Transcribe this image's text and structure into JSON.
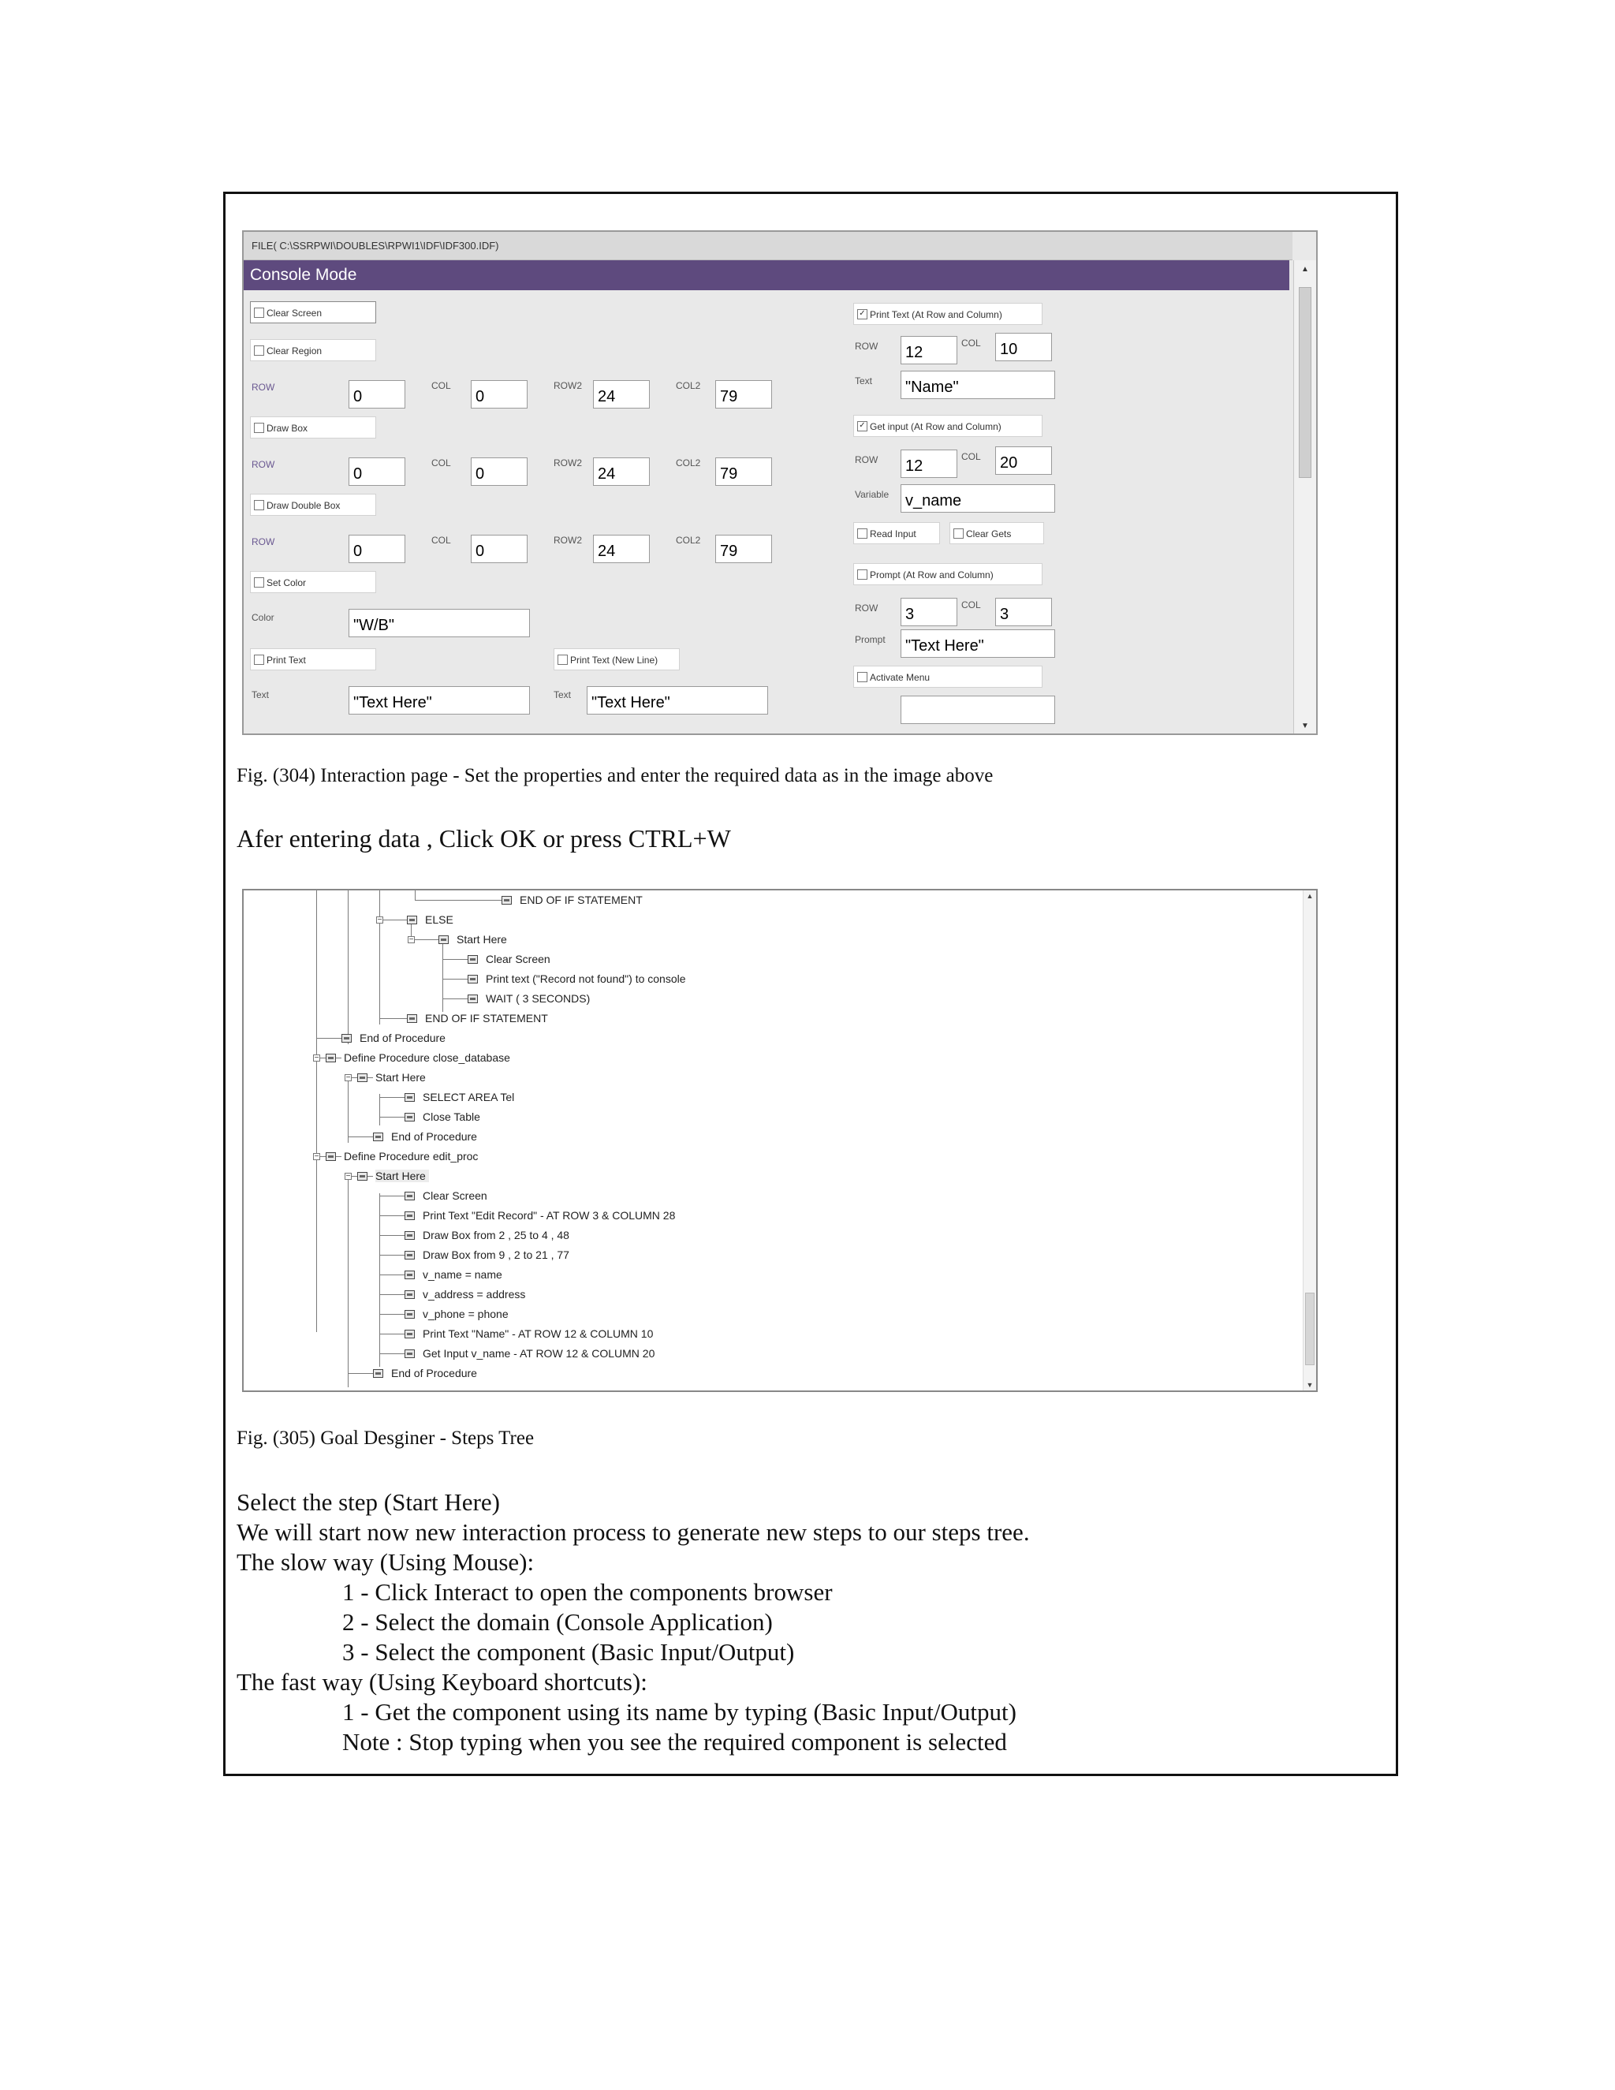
{
  "fig304": {
    "file_path": "FILE( C:\\SSRPWI\\DOUBLES\\RPWI1\\IDF\\IDF300.IDF)",
    "title": "Console Mode",
    "clear_screen": "Clear Screen",
    "clear_region": "Clear Region",
    "draw_box": "Draw Box",
    "draw_double_box": "Draw Double Box",
    "set_color": "Set Color",
    "color_label": "Color",
    "color_value": "\"W/B\"",
    "print_text": "Print Text",
    "print_text_newline": "Print Text (New Line)",
    "text_label": "Text",
    "text_value_1": "\"Text Here\"",
    "text_value_2": "\"Text Here\"",
    "row_label": "ROW",
    "col_label": "COL",
    "row2_label": "ROW2",
    "col2_label": "COL2",
    "region": {
      "row": "0",
      "col": "0",
      "row2": "24",
      "col2": "79"
    },
    "box": {
      "row": "0",
      "col": "0",
      "row2": "24",
      "col2": "79"
    },
    "double_box": {
      "row": "0",
      "col": "0",
      "row2": "24",
      "col2": "79"
    },
    "print_at": {
      "label": "Print Text (At Row and Column)",
      "checked": "✓",
      "row": "12",
      "col": "10",
      "text_label": "Text",
      "text": "\"Name\""
    },
    "get_input": {
      "label": "Get input (At Row and Column)",
      "checked": "✓",
      "row": "12",
      "col": "20",
      "variable_label": "Variable",
      "variable": "v_name"
    },
    "read_input": "Read Input",
    "clear_gets": "Clear Gets",
    "prompt_at": {
      "label": "Prompt (At Row and Column)",
      "row": "3",
      "col": "3",
      "prompt_label": "Prompt",
      "prompt": "\"Text Here\""
    },
    "activate_menu": "Activate Menu",
    "caption": "Fig. (304) Interaction page - Set the properties and enter the required data as in the image above"
  },
  "after_text": "Afer entering data , Click OK or press CTRL+W",
  "fig305": {
    "nodes": [
      "END OF IF STATEMENT",
      "ELSE",
      "Start Here",
      "Clear Screen",
      "Print text (\"Record not found\") to console",
      "WAIT ( 3 SECONDS)",
      "END OF IF STATEMENT",
      "End of Procedure",
      "Define Procedure close_database",
      "Start Here",
      "SELECT AREA Tel",
      "Close Table",
      "End of Procedure",
      "Define Procedure edit_proc",
      "Start Here",
      "Clear Screen",
      "Print Text \"Edit Record\" - AT ROW 3 & COLUMN 28",
      "Draw Box from 2 , 25 to 4 , 48",
      "Draw Box from 9 , 2 to 21 , 77",
      "v_name = name",
      "v_address = address",
      "v_phone = phone",
      "Print Text \"Name\" - AT ROW 12 & COLUMN 10",
      "Get Input v_name - AT ROW 12 & COLUMN 20",
      "End of Procedure"
    ],
    "caption": "Fig. (305) Goal Desginer - Steps Tree"
  },
  "instructions": [
    "Select the step (Start Here)",
    "We will start now new interaction process to generate new steps to our steps tree.",
    "The slow way (Using Mouse):",
    "1 - Click Interact to open the components browser",
    "2 - Select the domain (Console Application)",
    "3 - Select the component (Basic Input/Output)",
    "The fast way (Using Keyboard shortcuts):",
    "1 - Get the component using its name by typing (Basic Input/Output)",
    "Note : Stop typing when you see the required component is selected"
  ]
}
